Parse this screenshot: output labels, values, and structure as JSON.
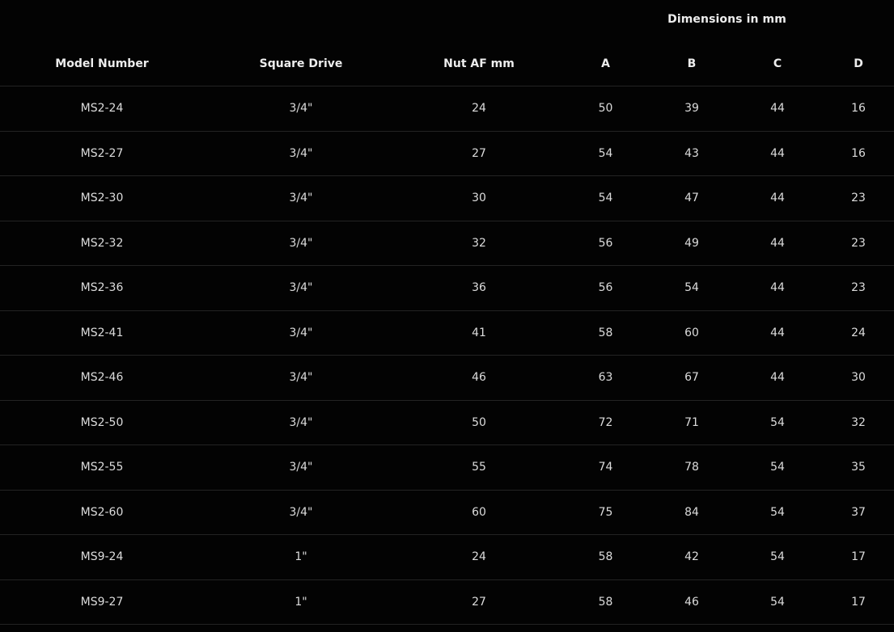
{
  "table": {
    "group_header": "Dimensions in mm",
    "headers": {
      "model": "Model Number",
      "drive": "Square Drive",
      "nut": "Nut AF mm",
      "a": "A",
      "b": "B",
      "c": "C",
      "d": "D"
    },
    "rows": [
      {
        "model": "MS2-24",
        "drive": "3/4\"",
        "nut": "24",
        "a": "50",
        "b": "39",
        "c": "44",
        "d": "16"
      },
      {
        "model": "MS2-27",
        "drive": "3/4\"",
        "nut": "27",
        "a": "54",
        "b": "43",
        "c": "44",
        "d": "16"
      },
      {
        "model": "MS2-30",
        "drive": "3/4\"",
        "nut": "30",
        "a": "54",
        "b": "47",
        "c": "44",
        "d": "23"
      },
      {
        "model": "MS2-32",
        "drive": "3/4\"",
        "nut": "32",
        "a": "56",
        "b": "49",
        "c": "44",
        "d": "23"
      },
      {
        "model": "MS2-36",
        "drive": "3/4\"",
        "nut": "36",
        "a": "56",
        "b": "54",
        "c": "44",
        "d": "23"
      },
      {
        "model": "MS2-41",
        "drive": "3/4\"",
        "nut": "41",
        "a": "58",
        "b": "60",
        "c": "44",
        "d": "24"
      },
      {
        "model": "MS2-46",
        "drive": "3/4\"",
        "nut": "46",
        "a": "63",
        "b": "67",
        "c": "44",
        "d": "30"
      },
      {
        "model": "MS2-50",
        "drive": "3/4\"",
        "nut": "50",
        "a": "72",
        "b": "71",
        "c": "54",
        "d": "32"
      },
      {
        "model": "MS2-55",
        "drive": "3/4\"",
        "nut": "55",
        "a": "74",
        "b": "78",
        "c": "54",
        "d": "35"
      },
      {
        "model": "MS2-60",
        "drive": "3/4\"",
        "nut": "60",
        "a": "75",
        "b": "84",
        "c": "54",
        "d": "37"
      },
      {
        "model": "MS9-24",
        "drive": "1\"",
        "nut": "24",
        "a": "58",
        "b": "42",
        "c": "54",
        "d": "17"
      },
      {
        "model": "MS9-27",
        "drive": "1\"",
        "nut": "27",
        "a": "58",
        "b": "46",
        "c": "54",
        "d": "17"
      }
    ]
  },
  "colors": {
    "background": "#030303",
    "text": "#dcdcdc",
    "row_divider": "#232323"
  }
}
